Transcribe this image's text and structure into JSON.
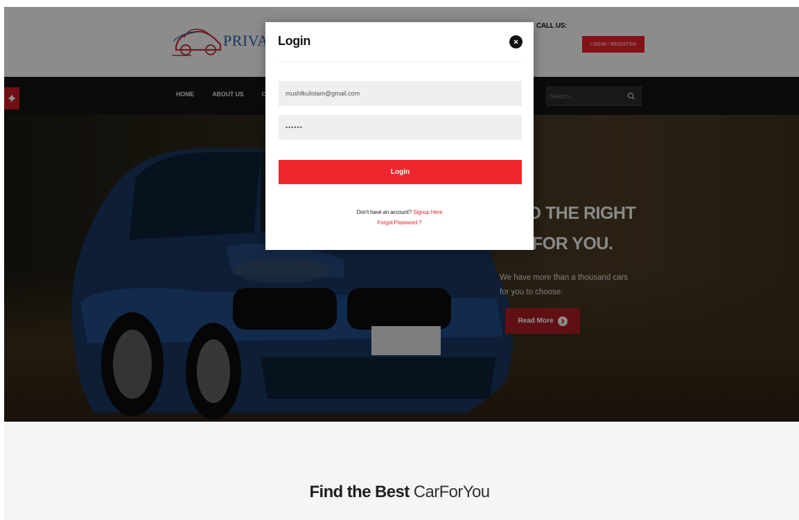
{
  "header": {
    "logo_text": "PRIVATE",
    "call_us": "CALL US:",
    "login_register": "LOGIN / REGISTER"
  },
  "nav": {
    "items": [
      "HOME",
      "ABOUT US",
      "CA"
    ],
    "search_placeholder": "Search..."
  },
  "hero": {
    "title_line1": "D THE RIGHT",
    "title_line2": "FOR YOU.",
    "description": "We have more than a thousand cars for you to choose.",
    "read_more": "Read More"
  },
  "section": {
    "title_bold": "Find the Best",
    "title_light": "CarForYou"
  },
  "modal": {
    "title": "Login",
    "email_value": "mushfkulislam@gmail.com",
    "password_value": "••••••",
    "login_button": "Login",
    "signup_prompt": "Don't have an account?",
    "signup_link": "Signup Here",
    "forgot_password": "Forgot Password ?"
  },
  "colors": {
    "accent_red": "#f0262f",
    "dark_red": "#a51c22",
    "logo_blue": "#2a5ea8"
  }
}
